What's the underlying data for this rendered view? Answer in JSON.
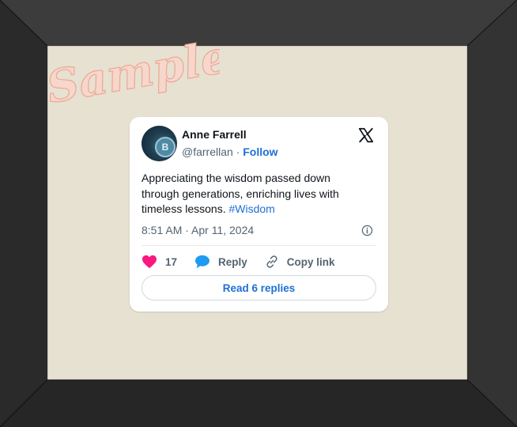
{
  "watermark": "Sample",
  "tweet": {
    "name": "Anne Farrell",
    "handle": "@farrellan",
    "separator": "·",
    "follow_label": "Follow",
    "text": "Appreciating the wisdom passed down through generations, enriching lives with timeless lessons.",
    "hashtag": "#Wisdom",
    "timestamp": "8:51 AM · Apr 11, 2024",
    "likes": "17",
    "reply_label": "Reply",
    "copy_link_label": "Copy link",
    "read_replies_label": "Read 6 replies"
  },
  "colors": {
    "accent": "#1d6fd6",
    "heart": "#f91880",
    "reply_bubble": "#1d9bf0",
    "mat": "#e7e1d2",
    "frame": "#2b2b2b"
  },
  "icons": [
    "x-logo-icon",
    "info-icon",
    "heart-icon",
    "reply-icon",
    "link-icon"
  ]
}
